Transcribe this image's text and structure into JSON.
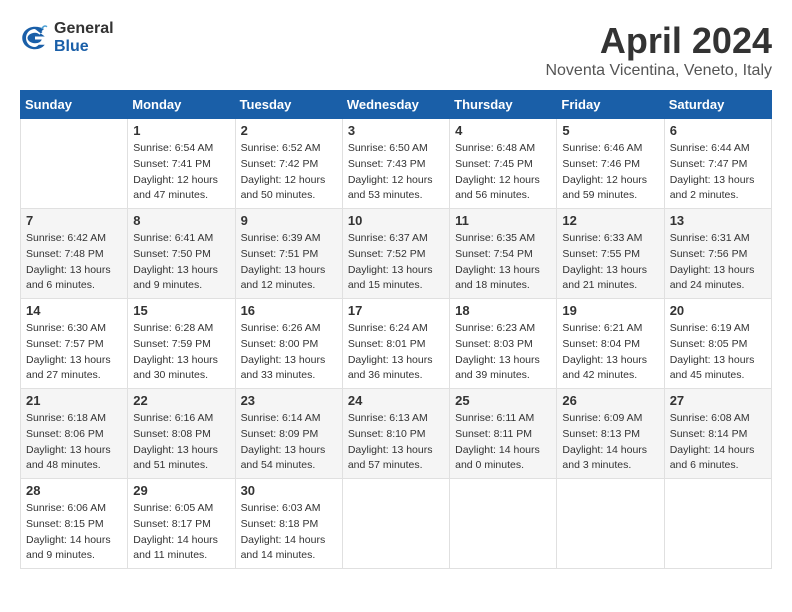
{
  "header": {
    "logo_general": "General",
    "logo_blue": "Blue",
    "month_title": "April 2024",
    "location": "Noventa Vicentina, Veneto, Italy"
  },
  "weekdays": [
    "Sunday",
    "Monday",
    "Tuesday",
    "Wednesday",
    "Thursday",
    "Friday",
    "Saturday"
  ],
  "weeks": [
    [
      {
        "day": "",
        "sunrise": "",
        "sunset": "",
        "daylight": ""
      },
      {
        "day": "1",
        "sunrise": "Sunrise: 6:54 AM",
        "sunset": "Sunset: 7:41 PM",
        "daylight": "Daylight: 12 hours and 47 minutes."
      },
      {
        "day": "2",
        "sunrise": "Sunrise: 6:52 AM",
        "sunset": "Sunset: 7:42 PM",
        "daylight": "Daylight: 12 hours and 50 minutes."
      },
      {
        "day": "3",
        "sunrise": "Sunrise: 6:50 AM",
        "sunset": "Sunset: 7:43 PM",
        "daylight": "Daylight: 12 hours and 53 minutes."
      },
      {
        "day": "4",
        "sunrise": "Sunrise: 6:48 AM",
        "sunset": "Sunset: 7:45 PM",
        "daylight": "Daylight: 12 hours and 56 minutes."
      },
      {
        "day": "5",
        "sunrise": "Sunrise: 6:46 AM",
        "sunset": "Sunset: 7:46 PM",
        "daylight": "Daylight: 12 hours and 59 minutes."
      },
      {
        "day": "6",
        "sunrise": "Sunrise: 6:44 AM",
        "sunset": "Sunset: 7:47 PM",
        "daylight": "Daylight: 13 hours and 2 minutes."
      }
    ],
    [
      {
        "day": "7",
        "sunrise": "Sunrise: 6:42 AM",
        "sunset": "Sunset: 7:48 PM",
        "daylight": "Daylight: 13 hours and 6 minutes."
      },
      {
        "day": "8",
        "sunrise": "Sunrise: 6:41 AM",
        "sunset": "Sunset: 7:50 PM",
        "daylight": "Daylight: 13 hours and 9 minutes."
      },
      {
        "day": "9",
        "sunrise": "Sunrise: 6:39 AM",
        "sunset": "Sunset: 7:51 PM",
        "daylight": "Daylight: 13 hours and 12 minutes."
      },
      {
        "day": "10",
        "sunrise": "Sunrise: 6:37 AM",
        "sunset": "Sunset: 7:52 PM",
        "daylight": "Daylight: 13 hours and 15 minutes."
      },
      {
        "day": "11",
        "sunrise": "Sunrise: 6:35 AM",
        "sunset": "Sunset: 7:54 PM",
        "daylight": "Daylight: 13 hours and 18 minutes."
      },
      {
        "day": "12",
        "sunrise": "Sunrise: 6:33 AM",
        "sunset": "Sunset: 7:55 PM",
        "daylight": "Daylight: 13 hours and 21 minutes."
      },
      {
        "day": "13",
        "sunrise": "Sunrise: 6:31 AM",
        "sunset": "Sunset: 7:56 PM",
        "daylight": "Daylight: 13 hours and 24 minutes."
      }
    ],
    [
      {
        "day": "14",
        "sunrise": "Sunrise: 6:30 AM",
        "sunset": "Sunset: 7:57 PM",
        "daylight": "Daylight: 13 hours and 27 minutes."
      },
      {
        "day": "15",
        "sunrise": "Sunrise: 6:28 AM",
        "sunset": "Sunset: 7:59 PM",
        "daylight": "Daylight: 13 hours and 30 minutes."
      },
      {
        "day": "16",
        "sunrise": "Sunrise: 6:26 AM",
        "sunset": "Sunset: 8:00 PM",
        "daylight": "Daylight: 13 hours and 33 minutes."
      },
      {
        "day": "17",
        "sunrise": "Sunrise: 6:24 AM",
        "sunset": "Sunset: 8:01 PM",
        "daylight": "Daylight: 13 hours and 36 minutes."
      },
      {
        "day": "18",
        "sunrise": "Sunrise: 6:23 AM",
        "sunset": "Sunset: 8:03 PM",
        "daylight": "Daylight: 13 hours and 39 minutes."
      },
      {
        "day": "19",
        "sunrise": "Sunrise: 6:21 AM",
        "sunset": "Sunset: 8:04 PM",
        "daylight": "Daylight: 13 hours and 42 minutes."
      },
      {
        "day": "20",
        "sunrise": "Sunrise: 6:19 AM",
        "sunset": "Sunset: 8:05 PM",
        "daylight": "Daylight: 13 hours and 45 minutes."
      }
    ],
    [
      {
        "day": "21",
        "sunrise": "Sunrise: 6:18 AM",
        "sunset": "Sunset: 8:06 PM",
        "daylight": "Daylight: 13 hours and 48 minutes."
      },
      {
        "day": "22",
        "sunrise": "Sunrise: 6:16 AM",
        "sunset": "Sunset: 8:08 PM",
        "daylight": "Daylight: 13 hours and 51 minutes."
      },
      {
        "day": "23",
        "sunrise": "Sunrise: 6:14 AM",
        "sunset": "Sunset: 8:09 PM",
        "daylight": "Daylight: 13 hours and 54 minutes."
      },
      {
        "day": "24",
        "sunrise": "Sunrise: 6:13 AM",
        "sunset": "Sunset: 8:10 PM",
        "daylight": "Daylight: 13 hours and 57 minutes."
      },
      {
        "day": "25",
        "sunrise": "Sunrise: 6:11 AM",
        "sunset": "Sunset: 8:11 PM",
        "daylight": "Daylight: 14 hours and 0 minutes."
      },
      {
        "day": "26",
        "sunrise": "Sunrise: 6:09 AM",
        "sunset": "Sunset: 8:13 PM",
        "daylight": "Daylight: 14 hours and 3 minutes."
      },
      {
        "day": "27",
        "sunrise": "Sunrise: 6:08 AM",
        "sunset": "Sunset: 8:14 PM",
        "daylight": "Daylight: 14 hours and 6 minutes."
      }
    ],
    [
      {
        "day": "28",
        "sunrise": "Sunrise: 6:06 AM",
        "sunset": "Sunset: 8:15 PM",
        "daylight": "Daylight: 14 hours and 9 minutes."
      },
      {
        "day": "29",
        "sunrise": "Sunrise: 6:05 AM",
        "sunset": "Sunset: 8:17 PM",
        "daylight": "Daylight: 14 hours and 11 minutes."
      },
      {
        "day": "30",
        "sunrise": "Sunrise: 6:03 AM",
        "sunset": "Sunset: 8:18 PM",
        "daylight": "Daylight: 14 hours and 14 minutes."
      },
      {
        "day": "",
        "sunrise": "",
        "sunset": "",
        "daylight": ""
      },
      {
        "day": "",
        "sunrise": "",
        "sunset": "",
        "daylight": ""
      },
      {
        "day": "",
        "sunrise": "",
        "sunset": "",
        "daylight": ""
      },
      {
        "day": "",
        "sunrise": "",
        "sunset": "",
        "daylight": ""
      }
    ]
  ]
}
